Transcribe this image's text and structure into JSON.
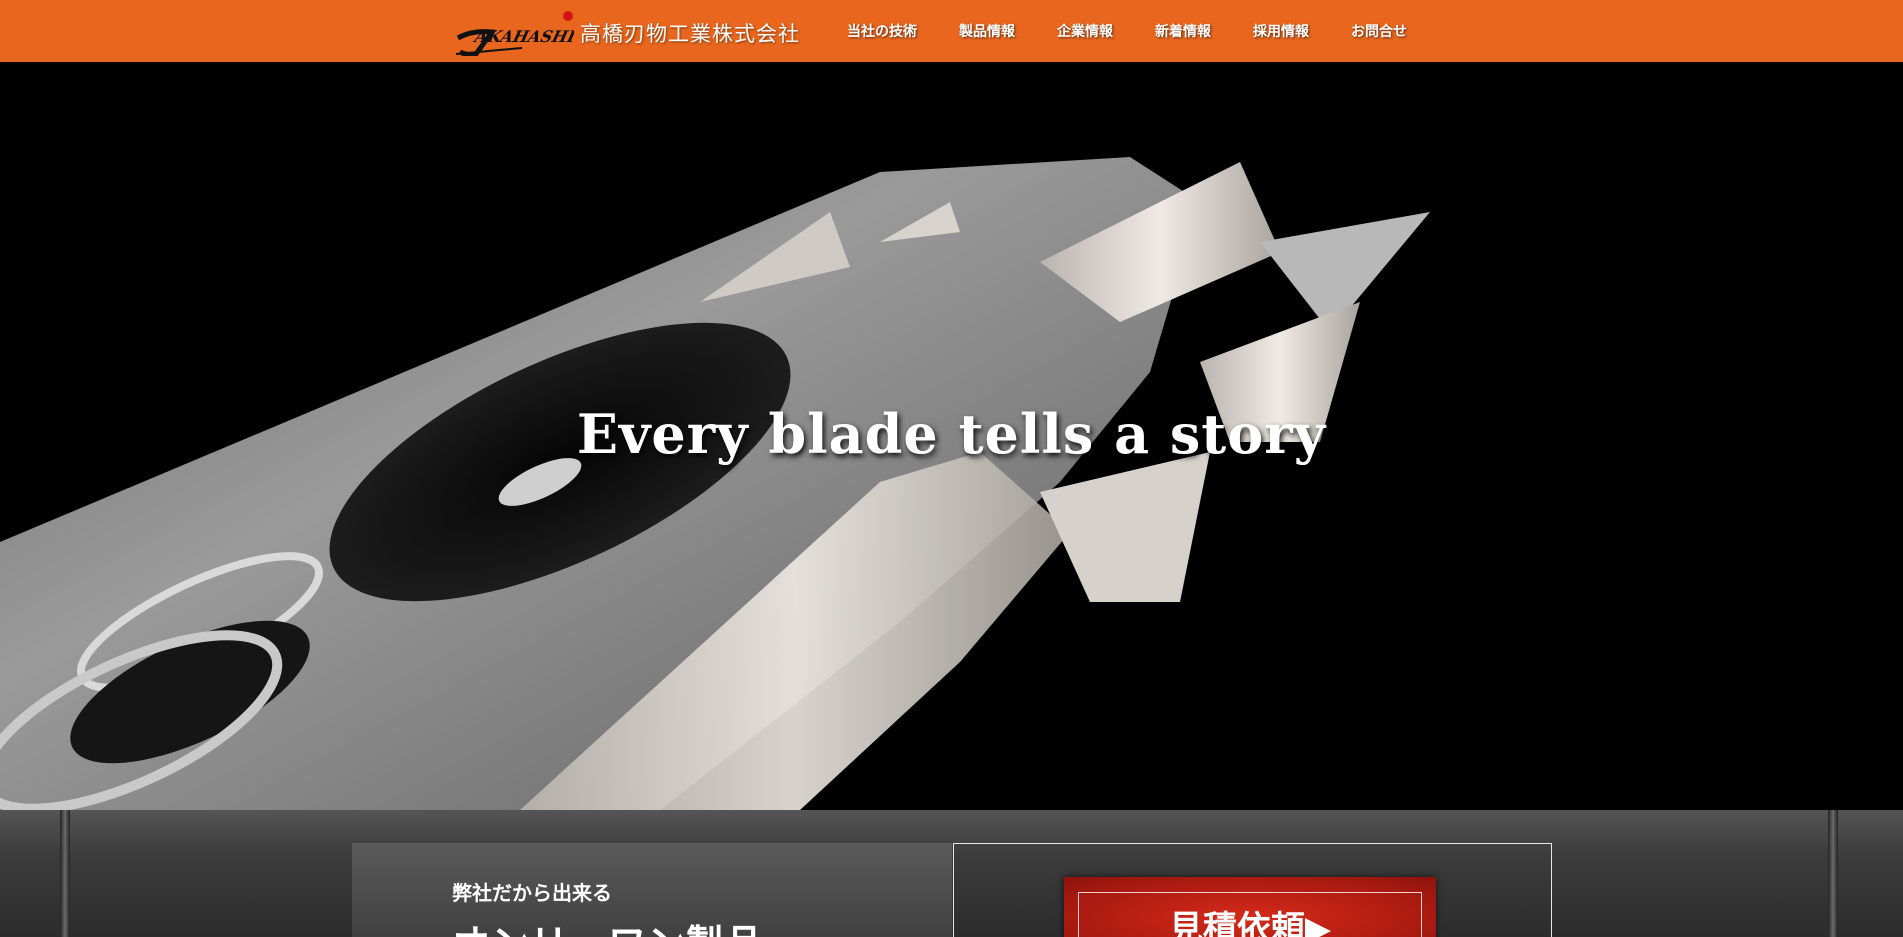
{
  "brand": {
    "logo_script": "TAKAHASHI",
    "company_name": "高橋刃物工業株式会社",
    "accent_color": "#e8661e"
  },
  "nav": {
    "items": [
      {
        "label": "当社の技術"
      },
      {
        "label": "製品情報"
      },
      {
        "label": "企業情報"
      },
      {
        "label": "新着情報"
      },
      {
        "label": "採用情報"
      },
      {
        "label": "お問合せ"
      }
    ]
  },
  "hero": {
    "title": "Every blade tells a story"
  },
  "feature": {
    "subtitle": "弊社だから出来る",
    "heading": "オンリーワン製品",
    "quote_button": "見積依頼▶",
    "button_color": "#b0201a"
  }
}
